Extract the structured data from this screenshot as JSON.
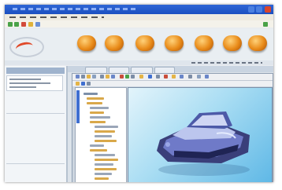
{
  "window": {
    "accent": "#2f66d6",
    "controls": [
      {
        "name": "minimize-button",
        "color": "#4a7fe0"
      },
      {
        "name": "maximize-button",
        "color": "#4a7fe0"
      },
      {
        "name": "close-button",
        "color": "#d9452b"
      }
    ]
  },
  "portal": {
    "logo_icon": "swirl-logo-icon",
    "nav_button_color": "#e88a18",
    "nav_buttons": [
      "nav-button-1",
      "nav-button-2",
      "nav-button-3",
      "nav-button-4",
      "nav-button-5",
      "nav-button-6",
      "nav-button-7"
    ]
  },
  "cad": {
    "model": "printer-3d-model",
    "viewport_background": "#a9ddf3",
    "tree_highlight": "#3f6fd0",
    "tree_item_color": "#d9a84a"
  }
}
